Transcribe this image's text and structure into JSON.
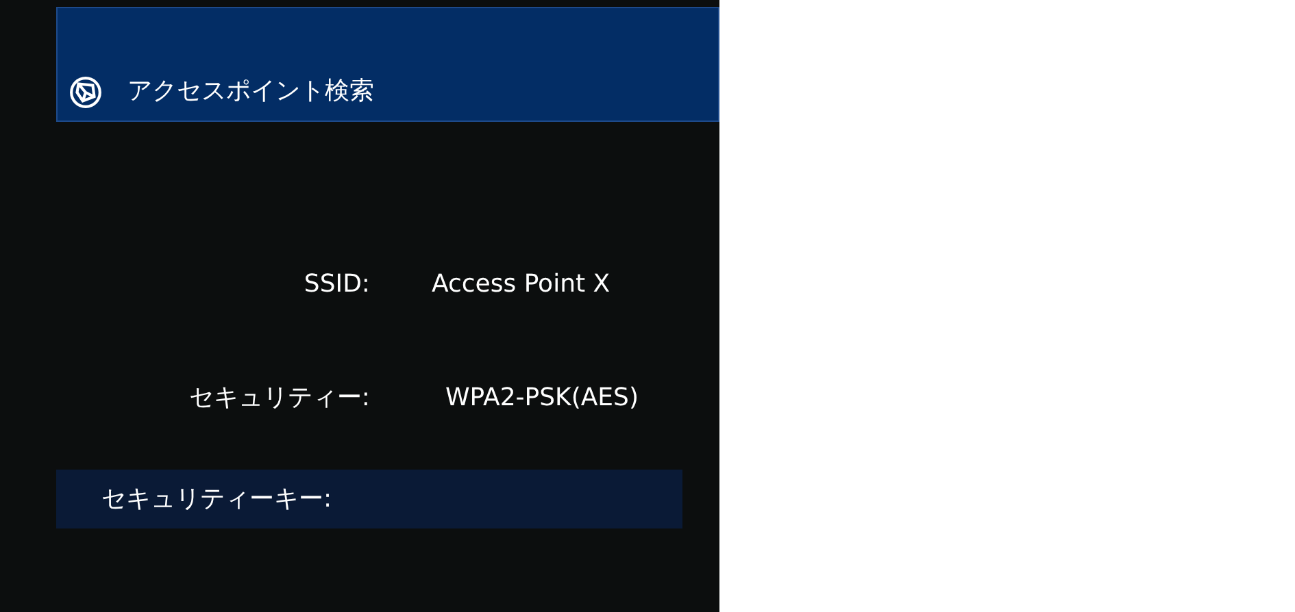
{
  "header": {
    "title": "アクセスポイント検索"
  },
  "rows": [
    {
      "kind": "info",
      "label": "SSID:",
      "value": "Access Point X"
    },
    {
      "kind": "info",
      "label": "セキュリティー:",
      "value": "WPA2-PSK(AES)"
    },
    {
      "kind": "field",
      "label": "セキュリティーキー:",
      "selected": true
    }
  ]
}
